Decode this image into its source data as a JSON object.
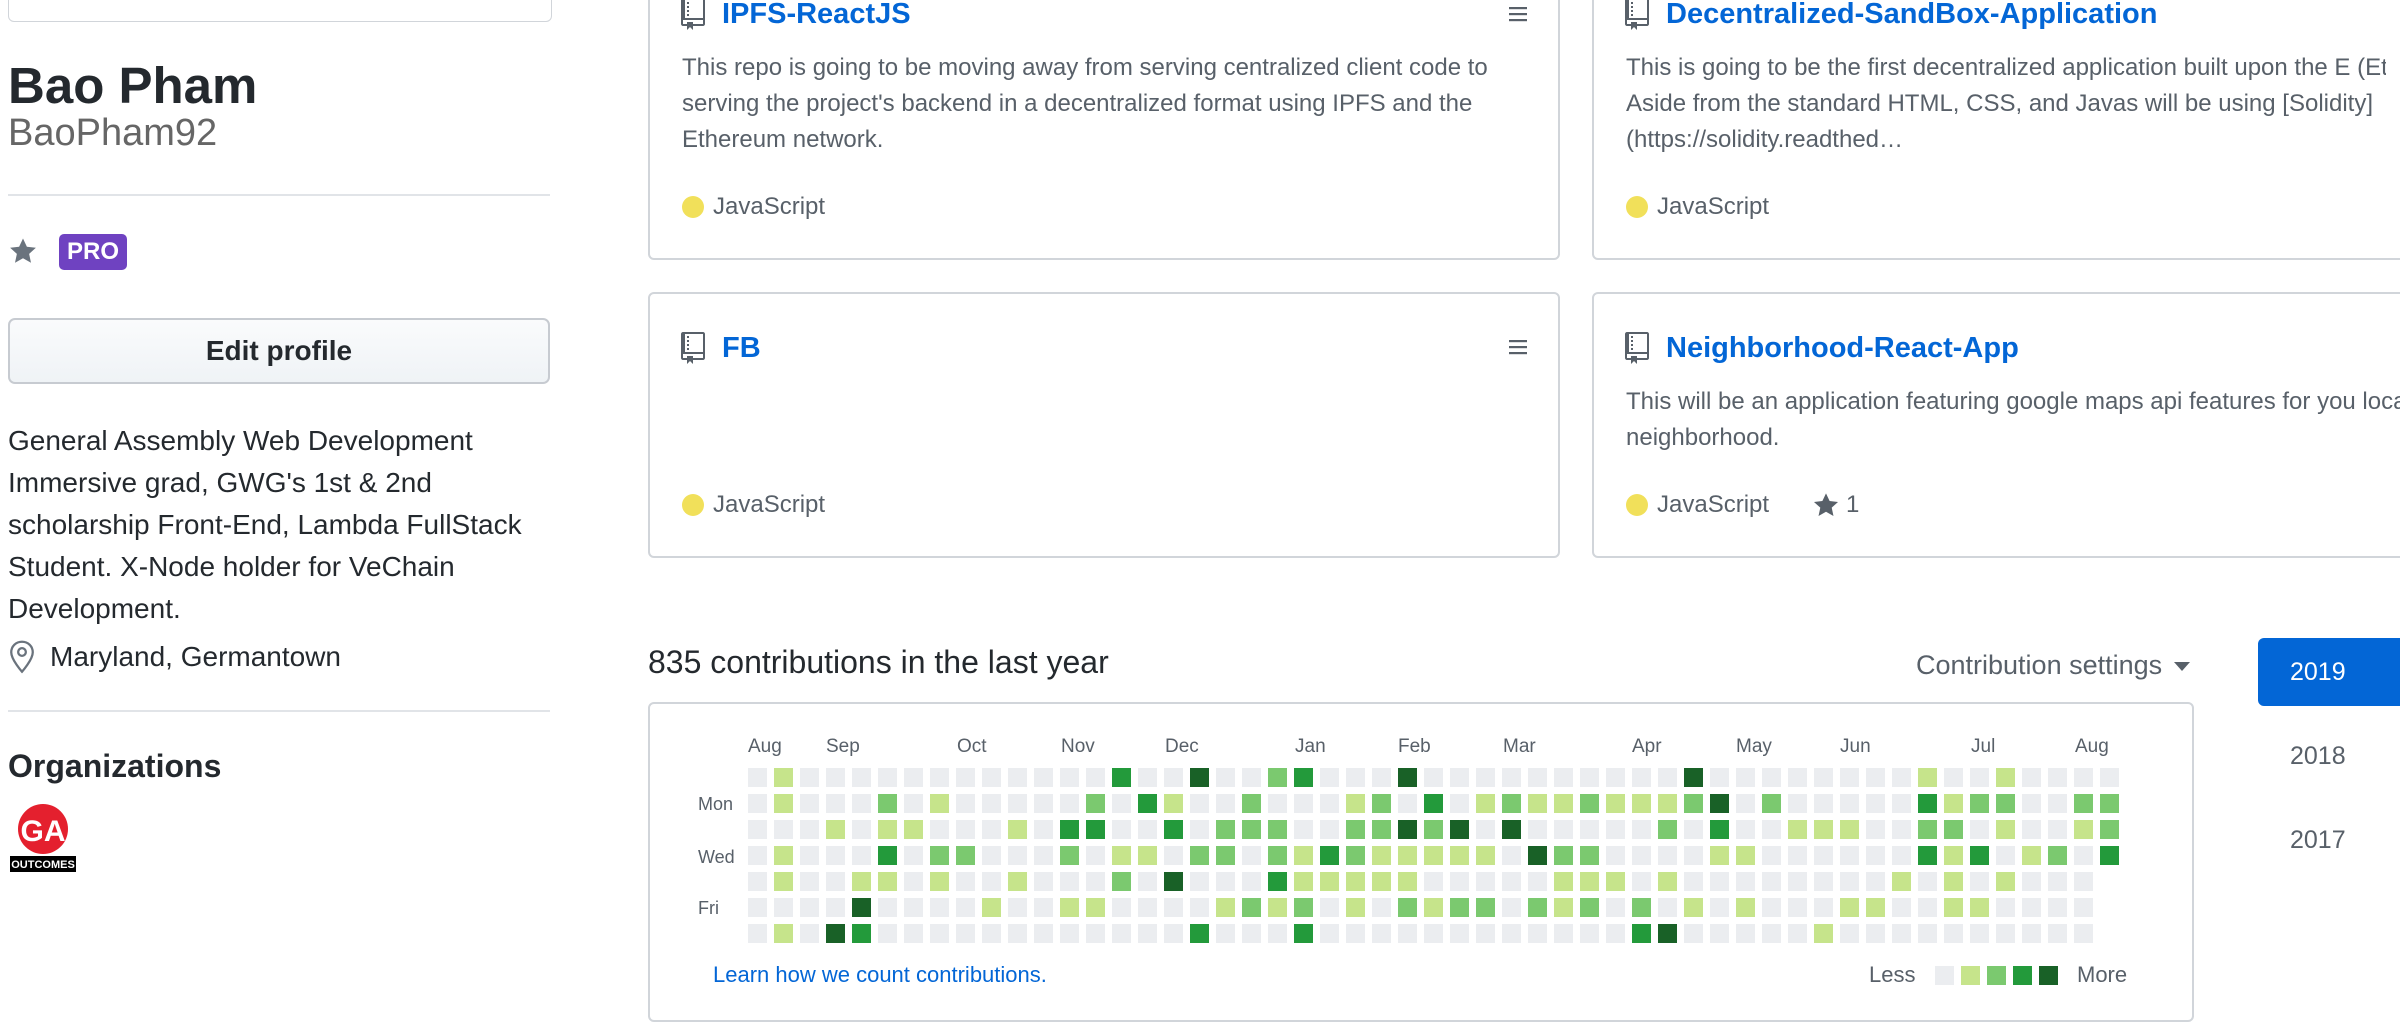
{
  "profile": {
    "full_name": "Bao Pham",
    "username": "BaoPham92",
    "badge": "PRO",
    "edit_button": "Edit profile",
    "bio": "General Assembly Web Development Immersive grad, GWG's 1st & 2nd scholarship Front-End, Lambda FullStack Student. X-Node holder for VeChain Development.",
    "location": "Maryland, Germantown",
    "organizations_title": "Organizations",
    "org_logo_text": "GA",
    "org_logo_caption": "OUTCOMES"
  },
  "repos": [
    {
      "name": "IPFS-ReactJS",
      "description": "This repo is going to be moving away from serving centralized client code to serving the project's backend in a decentralized format using IPFS and the Ethereum network.",
      "language": "JavaScript",
      "language_color": "#f1e05a",
      "stars": ""
    },
    {
      "name": "Decentralized-SandBox-Application",
      "description": "This is going to be the first decentralized application built upon the E (Ethereum) network. Aside from the standard HTML, CSS, and Javas will be using [Solidity](https://solidity.readthed…",
      "language": "JavaScript",
      "language_color": "#f1e05a",
      "stars": ""
    },
    {
      "name": "FB",
      "description": "",
      "language": "JavaScript",
      "language_color": "#f1e05a",
      "stars": ""
    },
    {
      "name": "Neighborhood-React-App",
      "description": "This will be an application featuring google maps api features for you local neighborhood.",
      "language": "JavaScript",
      "language_color": "#f1e05a",
      "stars": "1"
    }
  ],
  "contributions": {
    "title": "835 contributions in the last year",
    "settings_label": "Contribution settings",
    "months": [
      "Aug",
      "Sep",
      "Oct",
      "Nov",
      "Dec",
      "Jan",
      "Feb",
      "Mar",
      "Apr",
      "May",
      "Jun",
      "Jul",
      "Aug"
    ],
    "day_labels": [
      "Mon",
      "Wed",
      "Fri"
    ],
    "learn_link": "Learn how we count contributions.",
    "legend_less": "Less",
    "legend_more": "More",
    "level_colors": [
      "#ebedf0",
      "#c6e48b",
      "#7bc96f",
      "#239a3b",
      "#196127"
    ],
    "years": [
      {
        "label": "2019",
        "selected": true
      },
      {
        "label": "2018",
        "selected": false
      },
      {
        "label": "2017",
        "selected": false
      }
    ],
    "accent_color": "#0366d6"
  }
}
